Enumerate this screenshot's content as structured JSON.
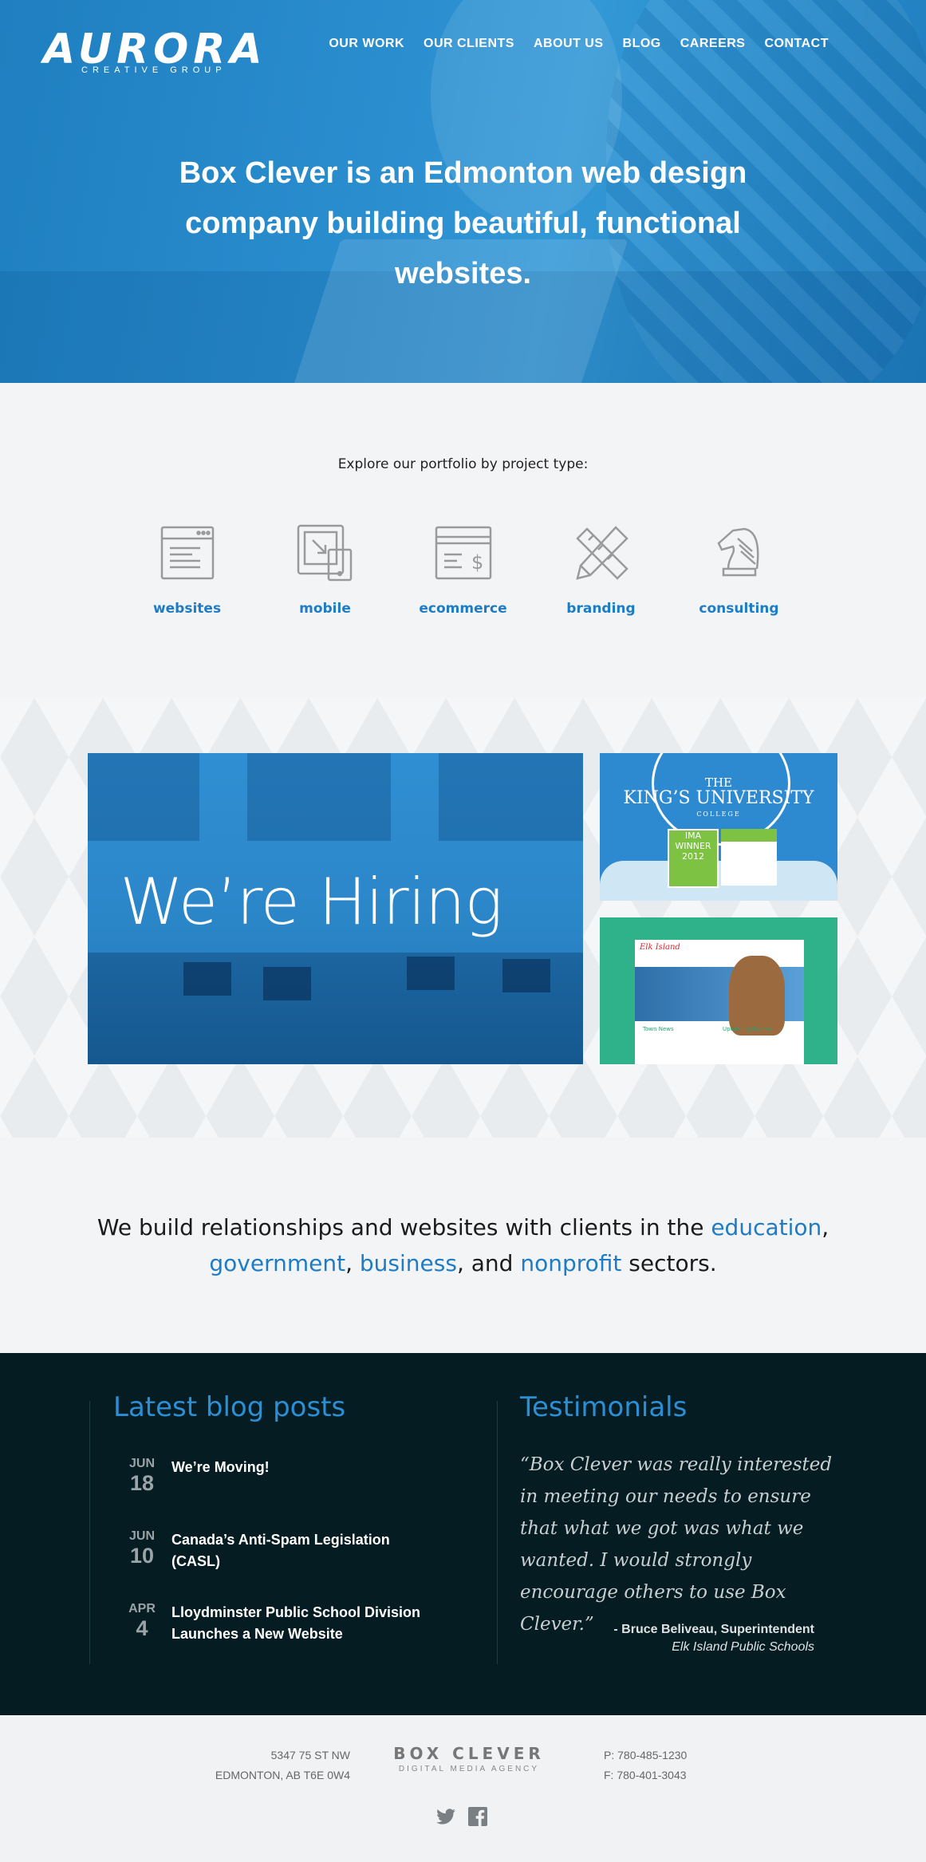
{
  "logo": {
    "main": "AURORA",
    "sub": "CREATIVE GROUP"
  },
  "nav": [
    "OUR WORK",
    "OUR CLIENTS",
    "ABOUT US",
    "BLOG",
    "CAREERS",
    "CONTACT"
  ],
  "hero": {
    "headline": "Box Clever is an Edmonton web design company building beautiful, functional websites."
  },
  "portfolio": {
    "intro": "Explore our portfolio by project type:",
    "types": [
      {
        "label": "websites",
        "icon": "browser-window-icon"
      },
      {
        "label": "mobile",
        "icon": "mobile-devices-icon"
      },
      {
        "label": "ecommerce",
        "icon": "credit-card-icon"
      },
      {
        "label": "branding",
        "icon": "ruler-pencil-icon"
      },
      {
        "label": "consulting",
        "icon": "chess-knight-icon"
      }
    ]
  },
  "feature": {
    "hiring": "We’re Hiring",
    "kings": {
      "line1": "THE",
      "line2": "KING’S UNIVERSITY",
      "line3": "COLLEGE",
      "award": "IMA WINNER 2012"
    },
    "school_site": {
      "logo": "Elk Island",
      "col1": "Town News",
      "col2": "Upcoming Events"
    }
  },
  "sectors": {
    "prefix": "We build relationships and websites with clients in the ",
    "education": "education",
    "comma1": ",",
    "government": "government",
    "comma2": ", ",
    "business": "business",
    "and": ", and ",
    "nonprofit": "nonprofit",
    "suffix": " sectors."
  },
  "blog": {
    "heading": "Latest blog posts",
    "posts": [
      {
        "month": "JUN",
        "day": "18",
        "title": "We’re Moving!"
      },
      {
        "month": "JUN",
        "day": "10",
        "title": "Canada’s Anti-Spam Legislation (CASL)"
      },
      {
        "month": "APR",
        "day": "4",
        "title": "Lloydminster Public School Division Launches a New Website"
      }
    ]
  },
  "testimonials": {
    "heading": "Testimonials",
    "quote": "“Box Clever was really interested in meeting our needs to ensure that what we got was what we wanted. I would strongly encourage others to use Box Clever.”",
    "author": "- Bruce Beliveau, Superintendent",
    "organization": "Elk Island Public Schools"
  },
  "footer": {
    "address1": "5347 75 ST NW",
    "address2": "EDMONTON, AB T6E 0W4",
    "brand": "BOX CLEVER",
    "tagline": "DIGITAL MEDIA AGENCY",
    "phone": "P: 780-485-1230",
    "fax": "F: 780-401-3043",
    "social": [
      "twitter-icon",
      "facebook-icon"
    ]
  },
  "colors": {
    "accent": "#1e7cc4",
    "hero": "#2b8fd0",
    "dark": "#041c22"
  }
}
